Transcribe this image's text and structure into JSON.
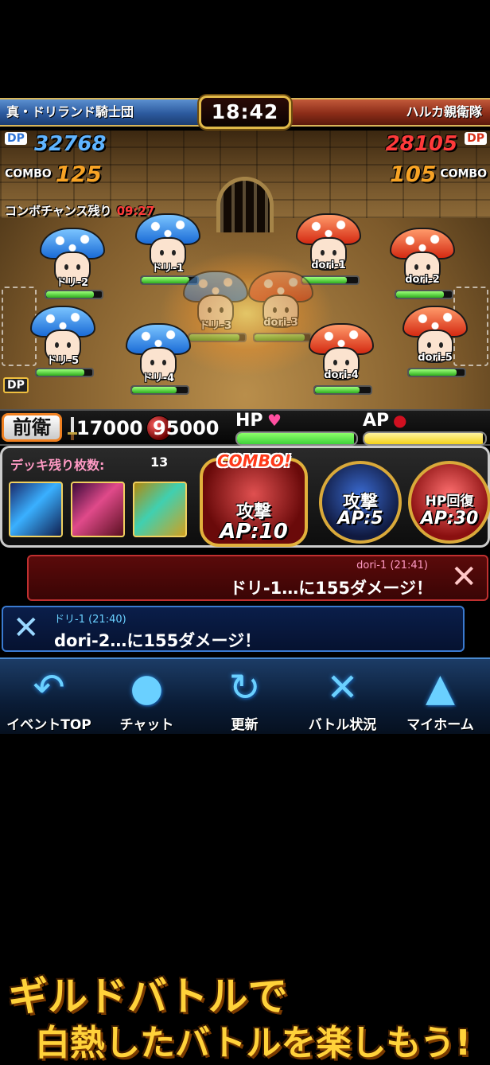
{
  "header": {
    "team_left": "真・ドリランド騎士団",
    "team_right": "ハルカ親衛隊",
    "timer": "18:42"
  },
  "score": {
    "left_dp_label": "DP",
    "left_dp": "32768",
    "right_dp": "28105",
    "right_dp_label": "DP",
    "combo_label": "COMBO",
    "left_combo": "125",
    "right_combo": "105",
    "chance_label": "コンボチャンス残り",
    "chance_time": "09:27"
  },
  "units": {
    "ally": [
      "ドリ-2",
      "ドリ-1",
      "ドリ-3",
      "ドリ-5",
      "ドリ-4"
    ],
    "enemy": [
      "dori-1",
      "dori-2",
      "dori-3",
      "dori-5",
      "dori-4"
    ],
    "hp_fraction": [
      0.85,
      0.85,
      0.9,
      0.85,
      0.8,
      0.8,
      0.85,
      0.9,
      0.85,
      0.8
    ]
  },
  "dp_badge": "DP",
  "stats": {
    "front_label": "前衛",
    "attack": "17000",
    "defense": "95000",
    "hp_label": "HP",
    "ap_label": "AP",
    "hp_fraction": 0.98,
    "ap_fraction": 0.98
  },
  "deck": {
    "label": "デッキ残り枚数:",
    "count": "13"
  },
  "skills": {
    "combo_tag": "COMBO!",
    "attack_title": "攻撃",
    "attack_ap": "AP:10",
    "dragon_title": "攻撃",
    "dragon_ap": "AP:5",
    "heal_title": "HP回復",
    "heal_ap": "AP:30"
  },
  "log": [
    {
      "meta": "dori-1 (21:41)",
      "message": "ドリ-1…に155ダメージ！"
    },
    {
      "meta": "ドリ-1 (21:40)",
      "message": "dori-2…に155ダメージ！"
    }
  ],
  "nav": [
    {
      "label": "イベントTOP",
      "icon": "back-arrow-icon"
    },
    {
      "label": "チャット",
      "icon": "chat-bubble-icon"
    },
    {
      "label": "更新",
      "icon": "refresh-icon"
    },
    {
      "label": "バトル状況",
      "icon": "crossed-swords-icon"
    },
    {
      "label": "マイホーム",
      "icon": "home-icon"
    }
  ],
  "promo": {
    "line1": "ギルドバトルで",
    "line2": "白熱したバトルを楽しもう!"
  },
  "colors": {
    "ally": "#2f74d6",
    "enemy": "#d8321a",
    "dp_left": "#5fb4ff",
    "dp_right": "#ff3a3a",
    "combo": "#f7a325",
    "hp_gauge": "#3fd23a",
    "ap_gauge": "#f5d21a",
    "promo": "#ffd23a"
  }
}
